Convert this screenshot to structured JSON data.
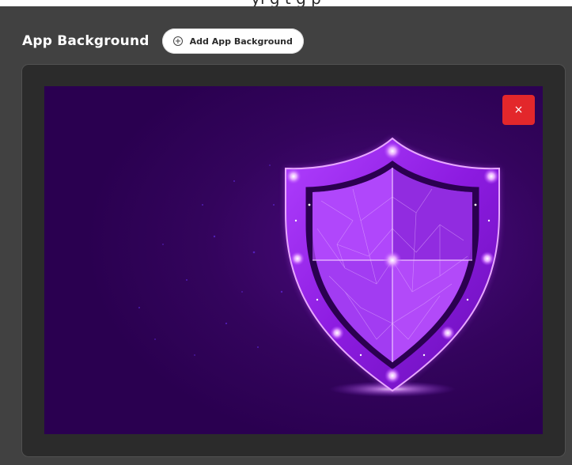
{
  "top_strip": {
    "text": "yi g t g p"
  },
  "section": {
    "title": "App Background",
    "add_button_label": "Add App Background",
    "add_icon": "plus-circle-icon"
  },
  "preview": {
    "image_subject": "glowing purple polygonal shield",
    "remove_label": "×",
    "remove_icon": "close-icon"
  },
  "colors": {
    "page_background": "#414141",
    "panel_background": "#2b2b2b",
    "image_background": "#2d0052",
    "shield_glow": "#c44bff",
    "remove_button": "#e3272b",
    "title_text": "#ffffff"
  }
}
